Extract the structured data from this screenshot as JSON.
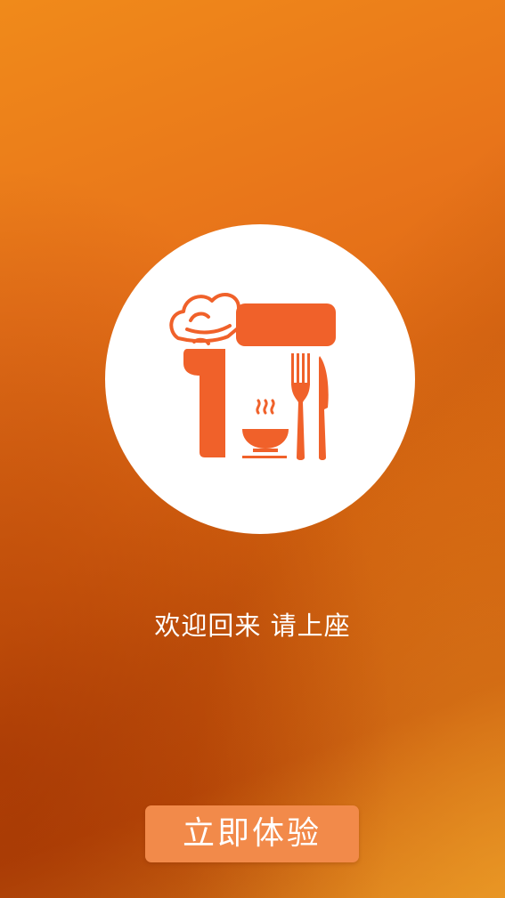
{
  "screen": {
    "welcome_text": "欢迎回来 请上座",
    "start_button_label": "立即体验"
  },
  "logo": {
    "icon": "restaurant-logo-icon",
    "color": "#f0612a"
  },
  "colors": {
    "background": "#e8741a",
    "button": "#f28a4a",
    "text": "#ffffff"
  }
}
